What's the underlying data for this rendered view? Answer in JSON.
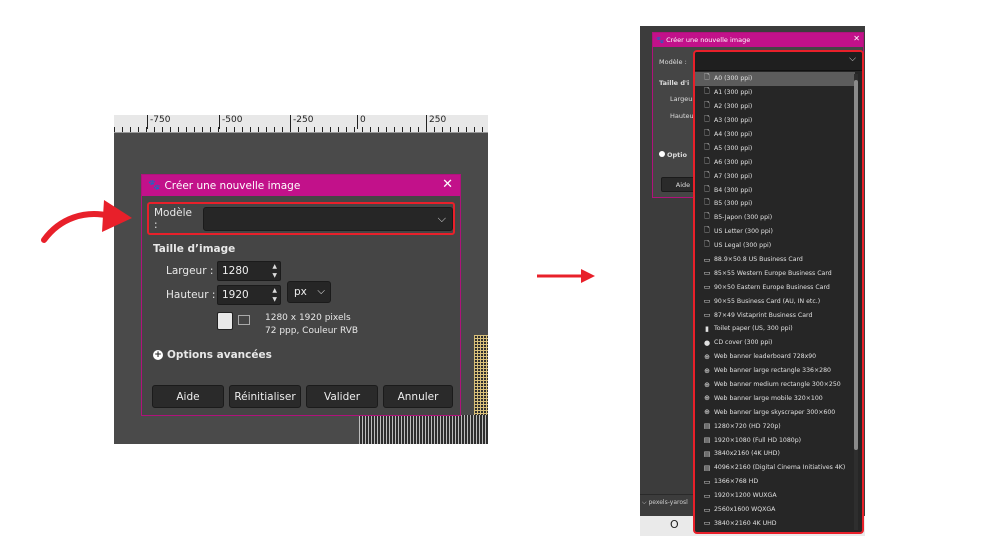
{
  "colors": {
    "dialog_titlebar": "#c2118a",
    "highlight_red": "#e8202a",
    "dialog_bg": "#454545",
    "input_bg": "#262626"
  },
  "left": {
    "ruler_labels": [
      "-750",
      "-500",
      "-250",
      "0",
      "250"
    ],
    "dialog": {
      "title": "Créer une nouvelle image",
      "template_label": "Modèle :",
      "template_value": "",
      "section_title": "Taille d’image",
      "width_label": "Largeur :",
      "width_value": "1280",
      "height_label": "Hauteur :",
      "height_value": "1920",
      "unit": "px",
      "info_line1": "1280 x 1920 pixels",
      "info_line2": "72 ppp, Couleur RVB",
      "advanced_options": "Options avancées",
      "buttons": {
        "help": "Aide",
        "reset": "Réinitialiser",
        "ok": "Valider",
        "cancel": "Annuler"
      }
    }
  },
  "right": {
    "background_dialog": {
      "title": "Créer une nouvelle image",
      "template_label": "Modèle :",
      "section_title": "Taille d'i",
      "width_label": "Largeur",
      "height_label": "Hauteur",
      "options_label": "Optio",
      "help_button": "Aide"
    },
    "bottom_tab": "pexels-yarosl",
    "dropdown_items": [
      {
        "icon": "document-icon",
        "label": "A0 (300 ppi)",
        "selected": true
      },
      {
        "icon": "document-icon",
        "label": "A1 (300 ppi)"
      },
      {
        "icon": "document-icon",
        "label": "A2 (300 ppi)"
      },
      {
        "icon": "document-icon",
        "label": "A3 (300 ppi)"
      },
      {
        "icon": "document-icon",
        "label": "A4 (300 ppi)"
      },
      {
        "icon": "document-icon",
        "label": "A5 (300 ppi)"
      },
      {
        "icon": "document-icon",
        "label": "A6 (300 ppi)"
      },
      {
        "icon": "document-icon",
        "label": "A7 (300 ppi)"
      },
      {
        "icon": "document-icon",
        "label": "B4 (300 ppi)"
      },
      {
        "icon": "document-icon",
        "label": "B5 (300 ppi)"
      },
      {
        "icon": "document-icon",
        "label": "B5-Japon (300 ppi)"
      },
      {
        "icon": "document-icon",
        "label": "US Letter (300 ppi)"
      },
      {
        "icon": "document-icon",
        "label": "US Legal (300 ppi)"
      },
      {
        "icon": "business-card-icon",
        "label": "88.9×50.8 US Business Card"
      },
      {
        "icon": "business-card-icon",
        "label": "85×55 Western Europe Business Card"
      },
      {
        "icon": "business-card-icon",
        "label": "90×50 Eastern Europe Business Card"
      },
      {
        "icon": "business-card-icon",
        "label": "90×55 Business Card (AU, IN etc.)"
      },
      {
        "icon": "business-card-icon",
        "label": "87×49 Vistaprint Business Card"
      },
      {
        "icon": "toilet-paper-icon",
        "label": "Toilet paper (US, 300 ppi)"
      },
      {
        "icon": "cd-icon",
        "label": "CD cover (300 ppi)"
      },
      {
        "icon": "globe-icon",
        "label": "Web banner leaderboard 728x90"
      },
      {
        "icon": "globe-icon",
        "label": "Web banner large rectangle 336×280"
      },
      {
        "icon": "globe-icon",
        "label": "Web banner medium rectangle 300×250"
      },
      {
        "icon": "globe-icon",
        "label": "Web banner large mobile 320×100"
      },
      {
        "icon": "globe-icon",
        "label": "Web banner large skyscraper 300×600"
      },
      {
        "icon": "film-icon",
        "label": "1280×720 (HD 720p)"
      },
      {
        "icon": "film-icon",
        "label": "1920×1080 (Full HD 1080p)"
      },
      {
        "icon": "film-icon",
        "label": "3840x2160 (4K UHD)"
      },
      {
        "icon": "film-icon",
        "label": "4096×2160 (Digital Cinema Initiatives 4K)"
      },
      {
        "icon": "monitor-icon",
        "label": "1366×768 HD"
      },
      {
        "icon": "monitor-icon",
        "label": "1920×1200 WUXGA"
      },
      {
        "icon": "monitor-icon",
        "label": "2560x1600 WQXGA"
      },
      {
        "icon": "monitor-icon",
        "label": "3840×2160 4K UHD"
      }
    ],
    "bottom_strip_glyph": "O"
  }
}
